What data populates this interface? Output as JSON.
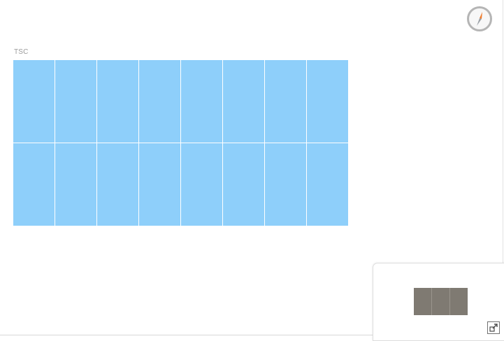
{
  "rack": {
    "label": "TSC",
    "rows": 2,
    "cols": 8,
    "cell_color": "#8ecffa"
  },
  "compass": {
    "icon": "compass-icon"
  },
  "minimap": {
    "rack_cells": 3,
    "rack_color": "#7f7a72"
  },
  "controls": {
    "expand_icon": "expand-minimap-icon"
  },
  "colors": {
    "background": "#ffffff",
    "accent": "#f07a2a",
    "border": "#d8d8d8"
  }
}
